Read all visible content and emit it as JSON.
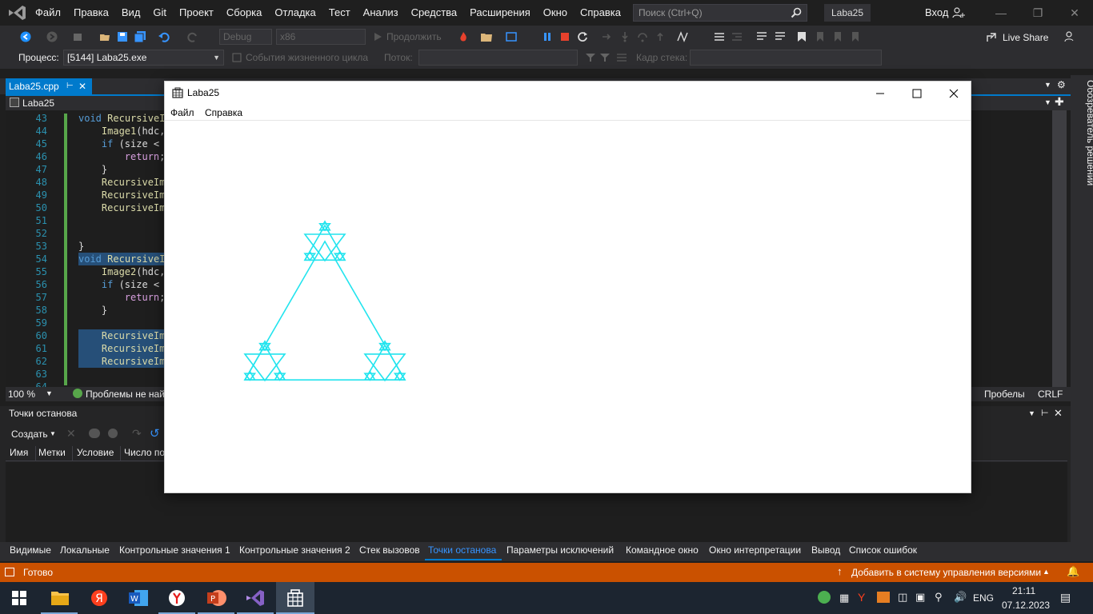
{
  "menubar": {
    "items": [
      "Файл",
      "Правка",
      "Вид",
      "Git",
      "Проект",
      "Сборка",
      "Отладка",
      "Тест",
      "Анализ",
      "Средства",
      "Расширения",
      "Окно",
      "Справка"
    ],
    "search_placeholder": "Поиск (Ctrl+Q)",
    "solution_name": "Laba25",
    "signin_label": "Вход"
  },
  "toolbar": {
    "config": "Debug",
    "platform": "x86",
    "continue_label": "Продолжить",
    "live_share_label": "Live Share"
  },
  "debug_location": {
    "process_label": "Процесс:",
    "process_value": "[5144] Laba25.exe",
    "lifecycle_label": "События жизненного цикла",
    "thread_label": "Поток:",
    "stack_frame_label": "Кадр стека:"
  },
  "document": {
    "tab_label": "Laba25.cpp",
    "nav_scope": "Laba25",
    "solution_explorer_label": "Обозреватель решений"
  },
  "editor": {
    "lines": [
      {
        "num": "43",
        "text": "void RecursiveI"
      },
      {
        "num": "44",
        "text": "    Image1(hdc,"
      },
      {
        "num": "45",
        "text": "    if (size <"
      },
      {
        "num": "46",
        "text": "        return;"
      },
      {
        "num": "47",
        "text": "    }"
      },
      {
        "num": "48",
        "text": "    RecursiveIma"
      },
      {
        "num": "49",
        "text": "    RecursiveIma"
      },
      {
        "num": "50",
        "text": "    RecursiveIma"
      },
      {
        "num": "51",
        "text": ""
      },
      {
        "num": "52",
        "text": ""
      },
      {
        "num": "53",
        "text": "}"
      },
      {
        "num": "54",
        "text": "void RecursiveI"
      },
      {
        "num": "55",
        "text": "    Image2(hdc,"
      },
      {
        "num": "56",
        "text": "    if (size <"
      },
      {
        "num": "57",
        "text": "        return;"
      },
      {
        "num": "58",
        "text": "    }"
      },
      {
        "num": "59",
        "text": ""
      },
      {
        "num": "60",
        "text": "    RecursiveIma"
      },
      {
        "num": "61",
        "text": "    RecursiveIma"
      },
      {
        "num": "62",
        "text": "    RecursiveIma"
      },
      {
        "num": "63",
        "text": ""
      },
      {
        "num": "64",
        "text": ""
      }
    ],
    "zoom": "100 %",
    "problems_text": "Проблемы не найд",
    "spaces_label": "Пробелы",
    "line_ending": "CRLF"
  },
  "breakpoints": {
    "title": "Точки останова",
    "create_label": "Создать",
    "columns": [
      "Имя",
      "Метки",
      "Условие",
      "Число по"
    ]
  },
  "bottom_tabs": {
    "items": [
      "Видимые",
      "Локальные",
      "Контрольные значения 1",
      "Контрольные значения 2",
      "Стек вызовов",
      "Точки останова",
      "Параметры исключений",
      "Командное окно",
      "Окно интерпретации",
      "Вывод",
      "Список ошибок"
    ],
    "active": "Точки останова"
  },
  "statusbar": {
    "ready": "Готово",
    "vcs_label": "Добавить в систему управления версиями"
  },
  "taskbar": {
    "lang": "ENG",
    "time": "21:11",
    "date": "07.12.2023"
  },
  "app_window": {
    "title": "Laba25",
    "menu": [
      "Файл",
      "Справка"
    ],
    "fractal_color": "#22e4ee"
  },
  "colors": {
    "accent": "#007acc",
    "status_bar": "#ca5100",
    "background": "#1e1e1e"
  }
}
